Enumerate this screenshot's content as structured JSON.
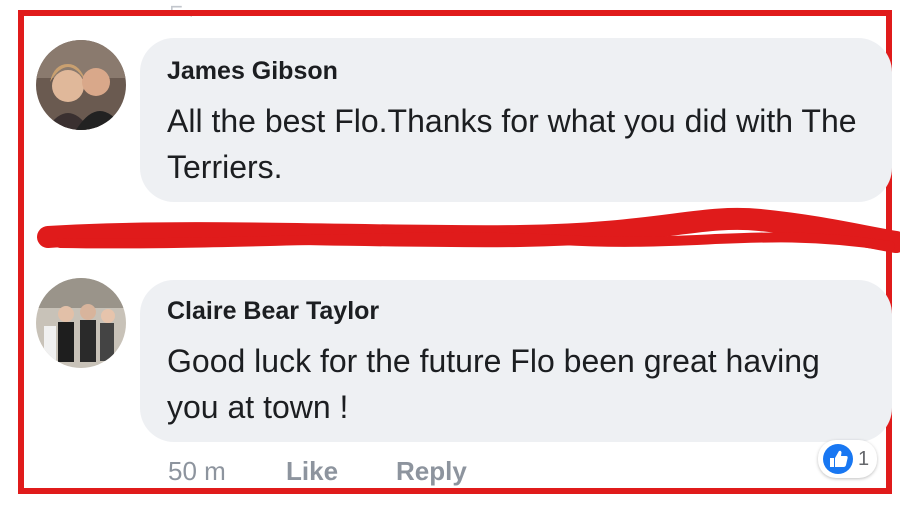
{
  "comments": [
    {
      "author": "James Gibson",
      "text": "All the best Flo.Thanks for what you did with The Terriers.",
      "avatar_icon": "profile-photo-icon"
    },
    {
      "author": "Claire Bear Taylor",
      "text": "Good luck for the future Flo been great having you at town !",
      "avatar_icon": "profile-photo-icon",
      "time": "50 m",
      "like_label": "Like",
      "reply_label": "Reply",
      "reaction_icon": "thumbs-up-icon",
      "reaction_count": "1"
    }
  ],
  "colors": {
    "annotation_red": "#e01b1b",
    "bubble": "#eef0f3",
    "like_blue": "#1877f2"
  }
}
